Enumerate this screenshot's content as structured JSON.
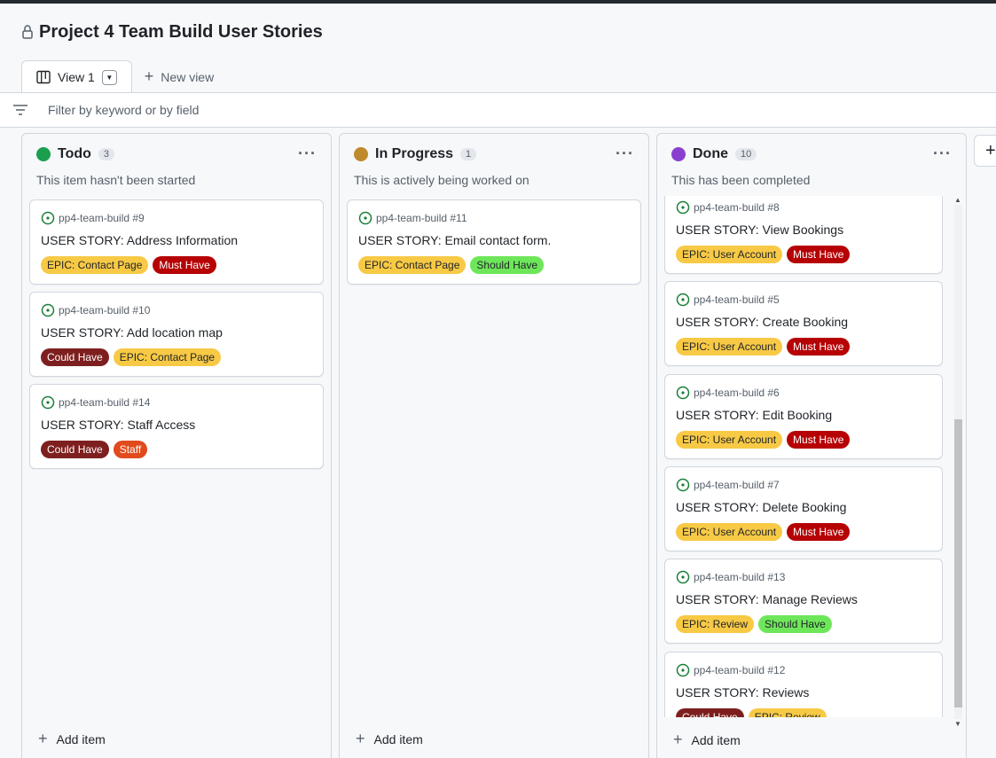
{
  "project": {
    "title": "Project 4 Team Build User Stories"
  },
  "tabs": {
    "view1": "View 1",
    "new_view": "New view"
  },
  "filter": {
    "placeholder": "Filter by keyword or by field"
  },
  "colors": {
    "todo": "#1a9f4f",
    "in_progress": "#bf8a2c",
    "done": "#8b3fd1",
    "epic": "#f7c945",
    "must": "#b60205",
    "could": "#7e1f1f",
    "should": "#6ee65a",
    "staff": "#e14a1c"
  },
  "columns": [
    {
      "name": "Todo",
      "count": "3",
      "description": "This item hasn't been started",
      "add_label": "Add item",
      "cards": [
        {
          "ref": "pp4-team-build #9",
          "title": "USER STORY: Address Information",
          "labels": [
            [
              "EPIC: Contact Page",
              "epic"
            ],
            [
              "Must Have",
              "must"
            ]
          ]
        },
        {
          "ref": "pp4-team-build #10",
          "title": "USER STORY: Add location map",
          "labels": [
            [
              "Could Have",
              "could"
            ],
            [
              "EPIC: Contact Page",
              "epic"
            ]
          ]
        },
        {
          "ref": "pp4-team-build #14",
          "title": "USER STORY: Staff Access",
          "labels": [
            [
              "Could Have",
              "could"
            ],
            [
              "Staff",
              "staff"
            ]
          ]
        }
      ]
    },
    {
      "name": "In Progress",
      "count": "1",
      "description": "This is actively being worked on",
      "add_label": "Add item",
      "cards": [
        {
          "ref": "pp4-team-build #11",
          "title": "USER STORY: Email contact form.",
          "labels": [
            [
              "EPIC: Contact Page",
              "epic"
            ],
            [
              "Should Have",
              "should"
            ]
          ]
        }
      ]
    },
    {
      "name": "Done",
      "count": "10",
      "description": "This has been completed",
      "add_label": "Add item",
      "cards": [
        {
          "ref": "pp4-team-build #8",
          "title": "USER STORY: View Bookings",
          "labels": [
            [
              "EPIC: User Account",
              "epic"
            ],
            [
              "Must Have",
              "must"
            ]
          ]
        },
        {
          "ref": "pp4-team-build #5",
          "title": "USER STORY: Create Booking",
          "labels": [
            [
              "EPIC: User Account",
              "epic"
            ],
            [
              "Must Have",
              "must"
            ]
          ]
        },
        {
          "ref": "pp4-team-build #6",
          "title": "USER STORY: Edit Booking",
          "labels": [
            [
              "EPIC: User Account",
              "epic"
            ],
            [
              "Must Have",
              "must"
            ]
          ]
        },
        {
          "ref": "pp4-team-build #7",
          "title": "USER STORY: Delete Booking",
          "labels": [
            [
              "EPIC: User Account",
              "epic"
            ],
            [
              "Must Have",
              "must"
            ]
          ]
        },
        {
          "ref": "pp4-team-build #13",
          "title": "USER STORY: Manage Reviews",
          "labels": [
            [
              "EPIC: Review",
              "epic"
            ],
            [
              "Should Have",
              "should"
            ]
          ]
        },
        {
          "ref": "pp4-team-build #12",
          "title": "USER STORY: Reviews",
          "labels": [
            [
              "Could Have",
              "could"
            ],
            [
              "EPIC: Review",
              "epic"
            ]
          ]
        }
      ]
    }
  ]
}
